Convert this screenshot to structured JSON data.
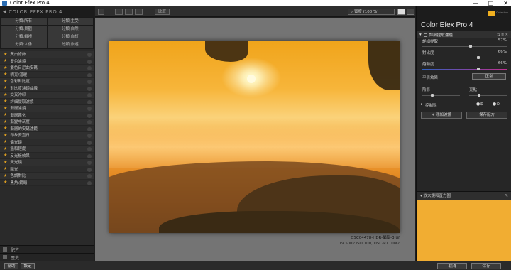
{
  "window": {
    "title": "Color Efex Pro 4",
    "controls": [
      "—",
      "□",
      "✕"
    ]
  },
  "left_panel": {
    "header": "COLOR EFEX PRO 4",
    "categories": [
      "分類:所有",
      "分類:主受",
      "分類:景觀",
      "分類:自然",
      "分類:婚禮",
      "分類:自訂",
      "分類:人像",
      "分類:旅遊"
    ],
    "filters": [
      {
        "label": "黃白修飾",
        "fav": true
      },
      {
        "label": "雙色濾鏡",
        "fav": true
      },
      {
        "label": "雙色日尼曲安碼",
        "fav": true
      },
      {
        "label": "明亮/溫暖",
        "fav": true
      },
      {
        "label": "色彩對比度",
        "fav": true
      },
      {
        "label": "對比度濾鏡曲線",
        "fav": true
      },
      {
        "label": "交叉沖印",
        "fav": true
      },
      {
        "label": "詳細提取濾鏡",
        "fav": true
      },
      {
        "label": "漸層濾鏡",
        "fav": true
      },
      {
        "label": "漸層霧化",
        "fav": true
      },
      {
        "label": "漸變中灰度",
        "fav": true
      },
      {
        "label": "漸層的安碼濾鏡",
        "fav": true
      },
      {
        "label": "印象安直日",
        "fav": true
      },
      {
        "label": "偏光鏡",
        "fav": true
      },
      {
        "label": "溫和輕度",
        "fav": true
      },
      {
        "label": "反光板效果",
        "fav": true
      },
      {
        "label": "天光鏡",
        "fav": true
      },
      {
        "label": "陽光",
        "fav": true
      },
      {
        "label": "色調對比",
        "fav": true
      },
      {
        "label": "黑角:鏡頭",
        "fav": true
      }
    ],
    "footer": [
      "配方",
      "歷史"
    ]
  },
  "toolbar": {
    "compare_label": "比較",
    "zoom_label": "寬度 (100 %)"
  },
  "image": {
    "caption_line1": "DSC04478-HDR-編輯-3.tif",
    "caption_line2": "19.5 MP ISO 100, DSC-RX10M2"
  },
  "right_panel": {
    "title": "Color Efex Pro",
    "title_num": "4",
    "logo_text": "Collection",
    "filter_name": "詳細提取濾鏡",
    "sliders": [
      {
        "label": "詳細提取",
        "value": "57%",
        "fraction": 0.57
      },
      {
        "label": "對比度",
        "value": "66%",
        "fraction": 0.66
      },
      {
        "label": "飽和度",
        "value": "66%",
        "fraction": 0.66
      }
    ],
    "mode_label": "平滑效果",
    "mode_value": "正常",
    "shadows_label": "陰影",
    "highlights_label": "亮點",
    "control_points_label": "控制點",
    "add_filter_label": "添加濾鏡",
    "save_recipe_label": "保存配方",
    "loupe_label": "放大鏡和直方圖"
  },
  "bottom": {
    "help_label": "幫助",
    "settings_label": "設定",
    "cancel_label": "取消",
    "save_label": "保存"
  }
}
